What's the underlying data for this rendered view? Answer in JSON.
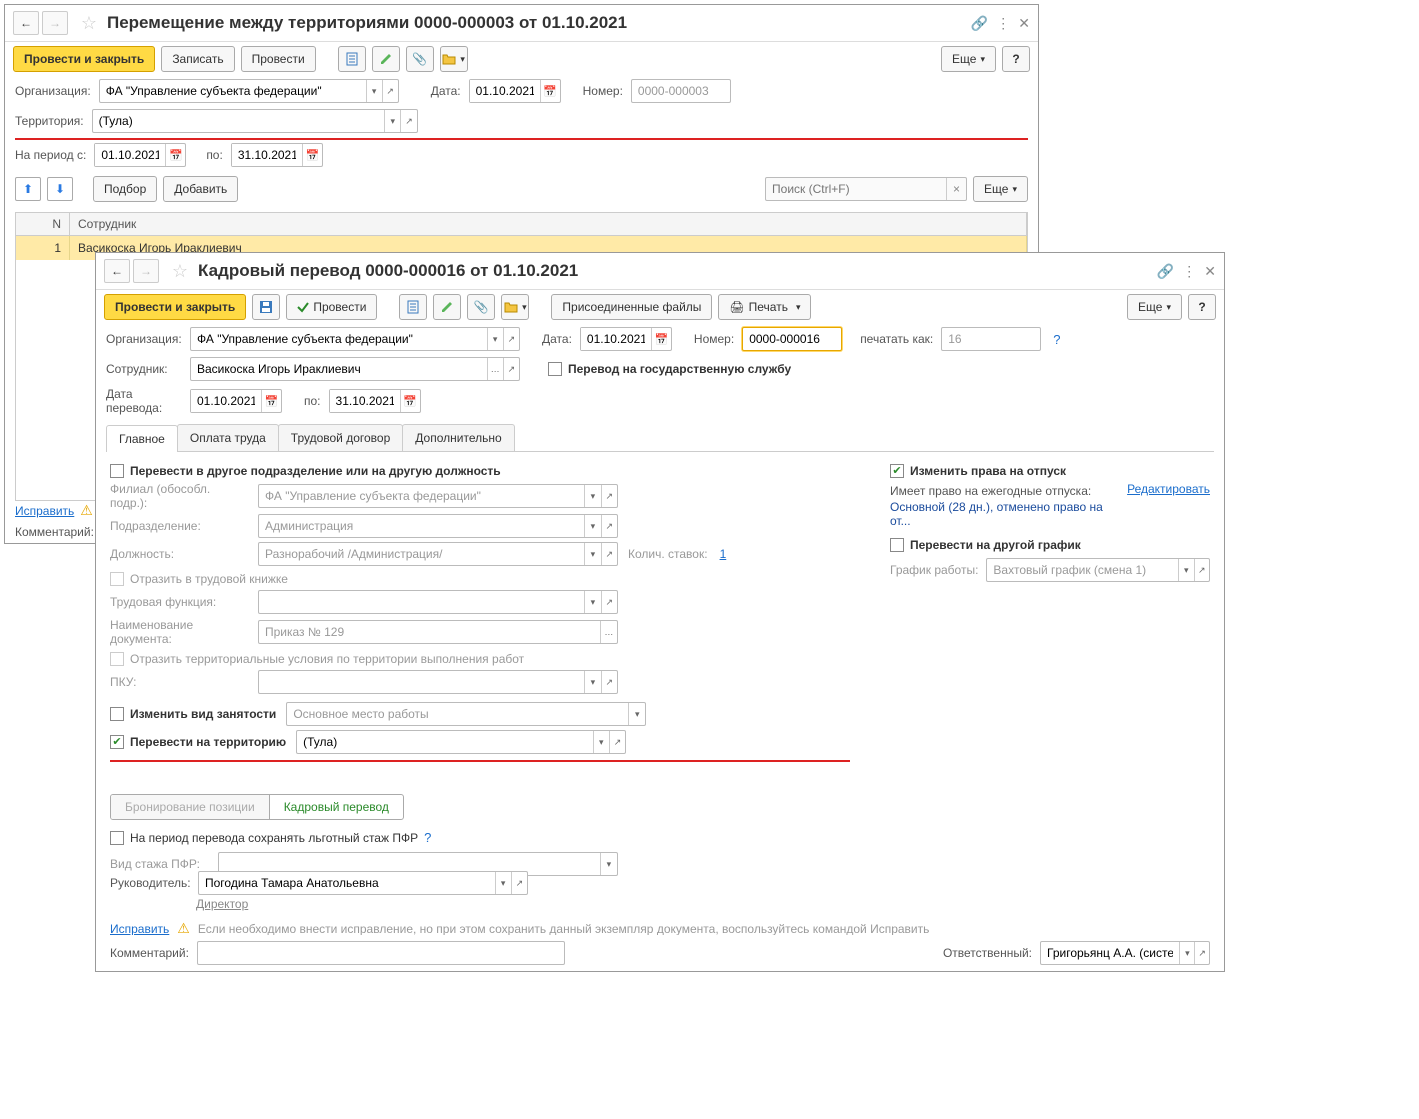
{
  "window1": {
    "title": "Перемещение между территориями 0000-000003 от 01.10.2021",
    "toolbar": {
      "post_close": "Провести и закрыть",
      "save": "Записать",
      "post": "Провести",
      "more": "Еще"
    },
    "labels": {
      "org": "Организация:",
      "date": "Дата:",
      "number": "Номер:",
      "territory": "Территория:",
      "period_from": "На период с:",
      "period_to": "по:"
    },
    "values": {
      "org": "ФА \"Управление субъекта федерации\"",
      "date": "01.10.2021",
      "number": "0000-000003",
      "territory": "(Тула)",
      "period_from": "01.10.2021",
      "period_to": "31.10.2021"
    },
    "table_toolbar": {
      "select": "Подбор",
      "add": "Добавить",
      "search_ph": "Поиск (Ctrl+F)",
      "more": "Еще"
    },
    "grid": {
      "headers": {
        "n": "N",
        "emp": "Сотрудник"
      },
      "rows": [
        {
          "n": "1",
          "emp": "Васикоска Игорь Ираклиевич"
        }
      ]
    },
    "footer": {
      "fix": "Исправить",
      "comment": "Комментарий:"
    }
  },
  "window2": {
    "title": "Кадровый перевод 0000-000016 от 01.10.2021",
    "toolbar": {
      "post_close": "Провести и закрыть",
      "post": "Провести",
      "files": "Присоединенные файлы",
      "print": "Печать",
      "more": "Еще"
    },
    "labels": {
      "org": "Организация:",
      "date": "Дата:",
      "number": "Номер:",
      "print_as": "печатать как:",
      "employee": "Сотрудник:",
      "gov_service": "Перевод на государственную службу",
      "transfer_date": "Дата перевода:",
      "transfer_to": "по:"
    },
    "values": {
      "org": "ФА \"Управление субъекта федерации\"",
      "date": "01.10.2021",
      "number": "0000-000016",
      "print_as": "16",
      "employee": "Васикоска Игорь Ираклиевич",
      "transfer_date": "01.10.2021",
      "transfer_to": "31.10.2021"
    },
    "tabs": {
      "main": "Главное",
      "pay": "Оплата труда",
      "contract": "Трудовой договор",
      "extra": "Дополнительно"
    },
    "main": {
      "chk_transfer": "Перевести в другое подразделение или на другую должность",
      "labels": {
        "branch": "Филиал (обособл. подр.):",
        "dept": "Подразделение:",
        "position": "Должность:",
        "rates": "Колич. ставок:",
        "reflect_wb": "Отразить в трудовой книжке",
        "job_func": "Трудовая функция:",
        "doc_name": "Наименование документа:",
        "reflect_terr": "Отразить территориальные условия по территории выполнения работ",
        "pku": "ПКУ:",
        "change_empl": "Изменить вид занятости",
        "transfer_terr": "Перевести на территорию"
      },
      "values": {
        "branch": "ФА \"Управление субъекта федерации\"",
        "dept": "Администрация",
        "position": "Разнорабочий /Администрация/",
        "rates": "1",
        "doc_name": "Приказ № 129",
        "change_empl": "Основное место работы",
        "transfer_terr": "(Тула)"
      },
      "btn_group": {
        "reserve": "Бронирование позиции",
        "transfer": "Кадровый перевод"
      },
      "chk_pfr": "На период перевода сохранять льготный стаж ПФР",
      "pfr_type": "Вид стажа ПФР:"
    },
    "right": {
      "chk_vacation": "Изменить права на отпуск",
      "vacation_info": "Имеет право на ежегодные отпуска:",
      "vacation_note": "Основной (28 дн.), отменено право на от...",
      "edit": "Редактировать",
      "chk_schedule": "Перевести на другой график",
      "schedule_lbl": "График работы:",
      "schedule_val": "Вахтовый график (смена 1)"
    },
    "footer": {
      "manager_lbl": "Руководитель:",
      "manager": "Погодина Тамара Анатольевна",
      "manager_pos": "Директор",
      "fix": "Исправить",
      "fix_note": "Если необходимо внести исправление, но при этом сохранить данный экземпляр документа, воспользуйтесь командой Исправить",
      "comment": "Комментарий:",
      "responsible_lbl": "Ответственный:",
      "responsible": "Григорьянц А.А. (системн"
    }
  }
}
